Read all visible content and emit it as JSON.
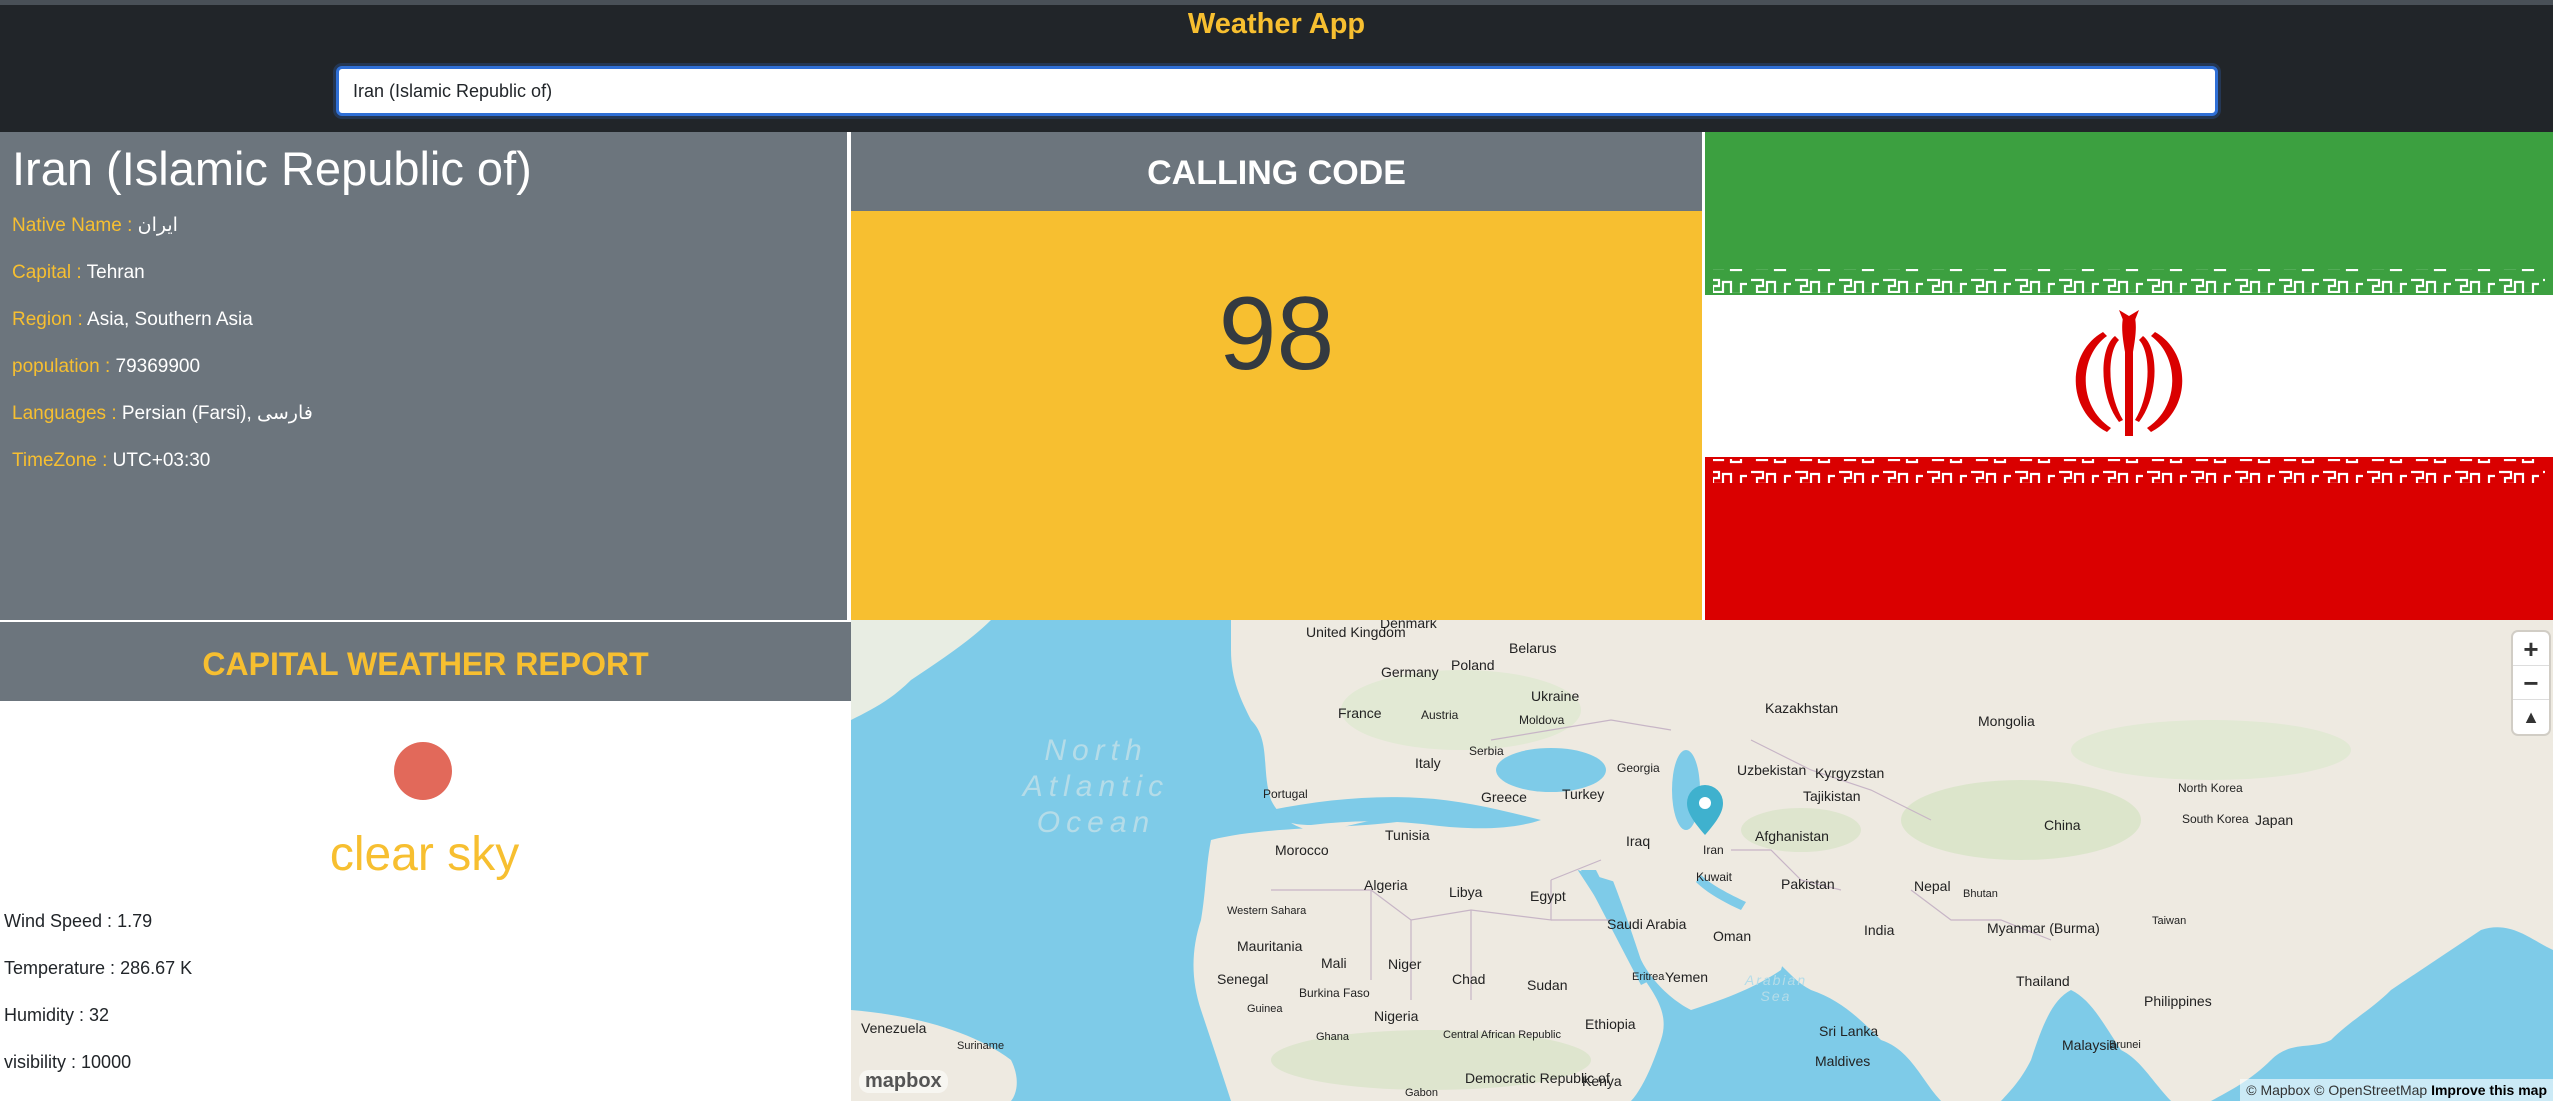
{
  "app": {
    "title": "Weather App",
    "search_value": "Iran (Islamic Republic of)"
  },
  "country": {
    "name": "Iran (Islamic Republic of)",
    "fields": [
      {
        "label": "Native Name :",
        "value": "ایران"
      },
      {
        "label": "Capital :",
        "value": "Tehran"
      },
      {
        "label": "Region :",
        "value": "Asia, Southern Asia"
      },
      {
        "label": "population :",
        "value": "79369900"
      },
      {
        "label": "Languages :",
        "value": "Persian (Farsi), فارسی"
      },
      {
        "label": "TimeZone :",
        "value": "UTC+03:30"
      }
    ]
  },
  "calling": {
    "title": "CALLING CODE",
    "code": "98"
  },
  "flag": {
    "icon": "iran-flag-icon",
    "colors": {
      "green": "#3ca040",
      "white": "#ffffff",
      "red": "#da0000"
    }
  },
  "weather": {
    "title": "CAPITAL WEATHER REPORT",
    "icon": "sun-icon",
    "description": "clear sky",
    "rows": [
      {
        "label": "Wind Speed :",
        "value": "1.79"
      },
      {
        "label": "Temperature :",
        "value": "286.67 K"
      },
      {
        "label": "Humidity :",
        "value": "32"
      },
      {
        "label": "visibility :",
        "value": "10000"
      }
    ]
  },
  "map": {
    "ocean_label": "North\nAtlantic\nOcean",
    "ocean_label_lines": [
      "North",
      "Atlantic",
      "Ocean"
    ],
    "sea_label_lines": [
      "Arabian",
      "Sea"
    ],
    "places": [
      "United Kingdom",
      "Denmark",
      "Germany",
      "Poland",
      "Belarus",
      "France",
      "Austria",
      "Ukraine",
      "Moldova",
      "Italy",
      "Serbia",
      "Portugal",
      "Greece",
      "Turkey",
      "Georgia",
      "Kazakhstan",
      "Mongolia",
      "Uzbekistan",
      "Kyrgyzstan",
      "Tajikistan",
      "North Korea",
      "South Korea",
      "Japan",
      "Tunisia",
      "Morocco",
      "Iraq",
      "Afghanistan",
      "China",
      "Algeria",
      "Libya",
      "Egypt",
      "Kuwait",
      "Pakistan",
      "Nepal",
      "Bhutan",
      "Western Sahara",
      "Saudi Arabia",
      "Oman",
      "India",
      "Taiwan",
      "Mauritania",
      "Mali",
      "Niger",
      "Myanmar (Burma)",
      "Senegal",
      "Burkina Faso",
      "Chad",
      "Sudan",
      "Eritrea",
      "Yemen",
      "Thailand",
      "Guinea",
      "Nigeria",
      "Philippines",
      "Ghana",
      "Central African Republic",
      "Ethiopia",
      "Venezuela",
      "Suriname",
      "Sri Lanka",
      "Malaysia",
      "Brunei",
      "Maldives",
      "Gabon",
      "Democratic Republic of",
      "Kenya",
      "Iran"
    ],
    "zoom_in": "+",
    "zoom_out": "−",
    "compass": "▲",
    "logo": "mapbox",
    "attribution": "© Mapbox © OpenStreetMap",
    "improve": "Improve this map"
  }
}
